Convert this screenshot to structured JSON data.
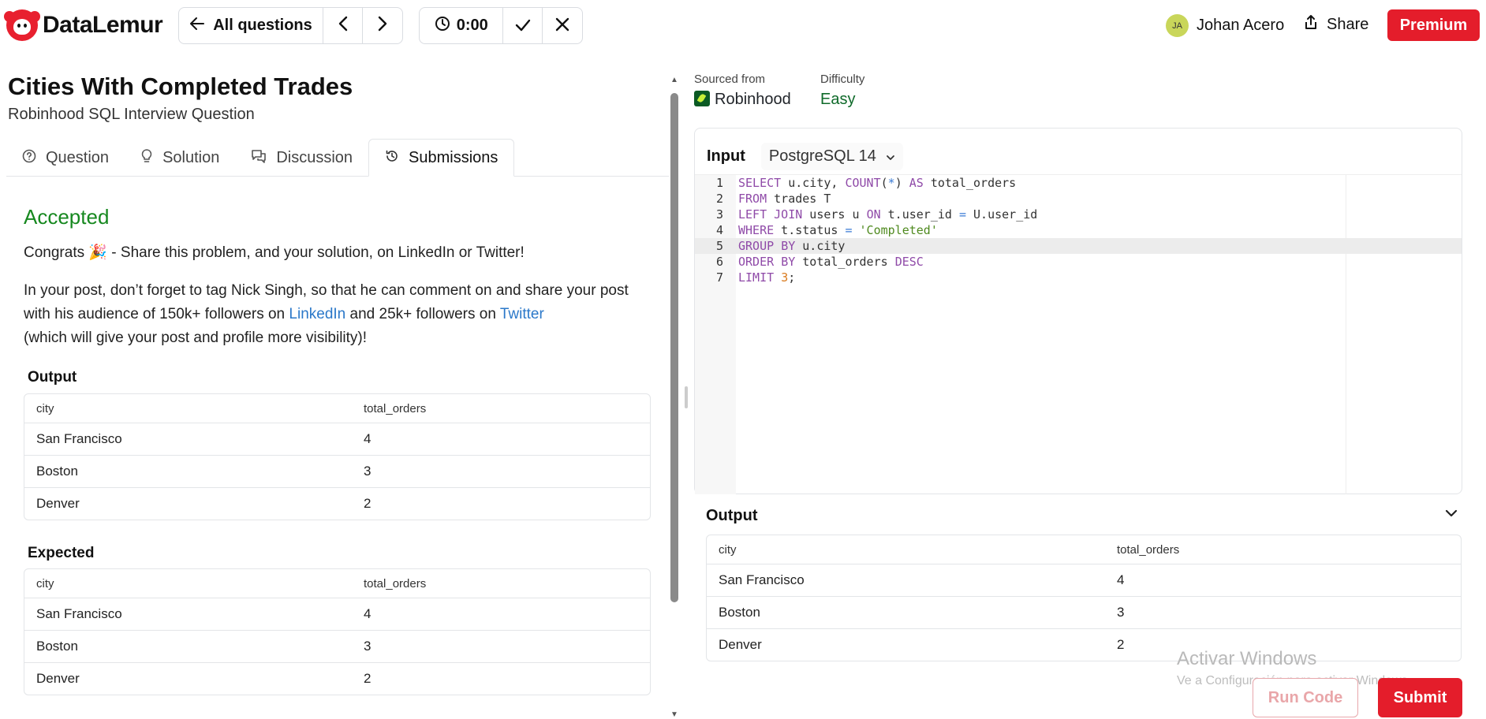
{
  "brand": {
    "name": "DataLemur"
  },
  "nav": {
    "all_questions": "All questions",
    "prev_icon": "chevron-left-icon",
    "next_icon": "chevron-right-icon"
  },
  "timer": {
    "value": "0:00"
  },
  "user": {
    "initials": "JA",
    "name": "Johan Acero"
  },
  "header": {
    "share": "Share",
    "premium": "Premium"
  },
  "question": {
    "title": "Cities With Completed Trades",
    "subtitle": "Robinhood SQL Interview Question"
  },
  "tabs": [
    {
      "label": "Question",
      "icon": "help-circle-icon"
    },
    {
      "label": "Solution",
      "icon": "lightbulb-icon"
    },
    {
      "label": "Discussion",
      "icon": "chat-icon"
    },
    {
      "label": "Submissions",
      "icon": "history-icon",
      "active": true
    }
  ],
  "submission": {
    "status": "Accepted",
    "congrats": "Congrats 🎉 - Share this problem, and your solution, on LinkedIn or Twitter!",
    "para_1": "In your post, don’t forget to tag Nick Singh, so that he can comment on and share your post with his audience of 150k+ followers on ",
    "linkedin": "LinkedIn",
    "para_2": " and 25k+ followers on ",
    "twitter": "Twitter",
    "para_3": "(which will give your post and profile more visibility)!"
  },
  "output_table": {
    "label": "Output",
    "columns": [
      "city",
      "total_orders"
    ],
    "rows": [
      [
        "San Francisco",
        "4"
      ],
      [
        "Boston",
        "3"
      ],
      [
        "Denver",
        "2"
      ]
    ]
  },
  "expected_table": {
    "label": "Expected",
    "columns": [
      "city",
      "total_orders"
    ],
    "rows": [
      [
        "San Francisco",
        "4"
      ],
      [
        "Boston",
        "3"
      ],
      [
        "Denver",
        "2"
      ]
    ]
  },
  "meta": {
    "sourced_label": "Sourced from",
    "sourced_value": "Robinhood",
    "difficulty_label": "Difficulty",
    "difficulty_value": "Easy",
    "difficulty_color": "#0f6a2a"
  },
  "editor": {
    "input_label": "Input",
    "language": "PostgreSQL 14",
    "lines": [
      "SELECT u.city, COUNT(*) AS total_orders",
      "FROM trades T",
      "LEFT JOIN users u ON t.user_id = U.user_id",
      "WHERE t.status = 'Completed'",
      "GROUP BY u.city",
      "ORDER BY total_orders DESC",
      "LIMIT 3;"
    ],
    "highlighted_line": 5
  },
  "result": {
    "label": "Output",
    "columns": [
      "city",
      "total_orders"
    ],
    "rows": [
      [
        "San Francisco",
        "4"
      ],
      [
        "Boston",
        "3"
      ],
      [
        "Denver",
        "2"
      ]
    ]
  },
  "watermark": {
    "line1": "Activar Windows",
    "line2": "Ve a Configuración para activar Windows."
  },
  "actions": {
    "run": "Run Code",
    "submit": "Submit"
  },
  "colors": {
    "brand_red": "#e41d2b",
    "accepted_green": "#16881f",
    "link_blue": "#2b78c9"
  }
}
